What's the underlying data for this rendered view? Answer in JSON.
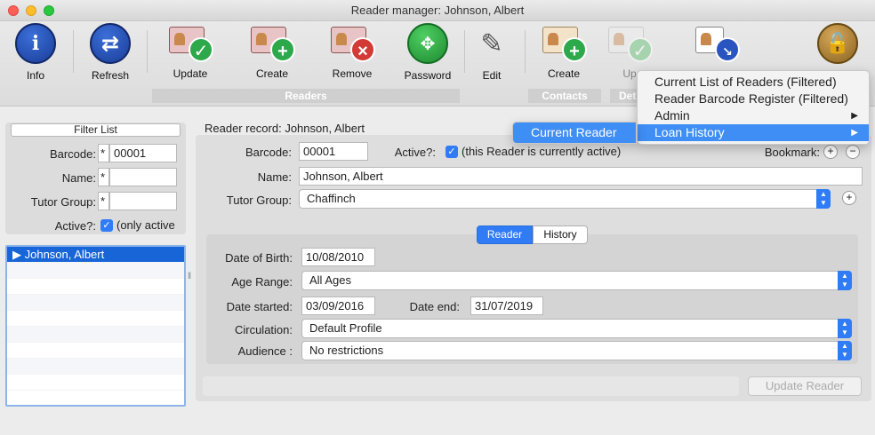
{
  "window": {
    "title": "Reader manager: Johnson, Albert"
  },
  "toolbar": {
    "info": "Info",
    "refresh": "Refresh",
    "update": "Update",
    "create": "Create",
    "remove": "Remove",
    "password": "Password",
    "edit": "Edit",
    "contacts_create": "Create",
    "up_partial": "Up",
    "groups": {
      "readers": "Readers",
      "contacts": "Contacts",
      "det_partial": "Det"
    }
  },
  "filter": {
    "title": "Filter List",
    "barcode_label": "Barcode:",
    "barcode_prefix": "*",
    "barcode_value": "00001",
    "name_label": "Name:",
    "name_prefix": "*",
    "tutor_label": "Tutor Group:",
    "tutor_prefix": "*",
    "active_label": "Active?:",
    "active_text": "(only active"
  },
  "reader_list": {
    "items": [
      "Johnson, Albert"
    ]
  },
  "record": {
    "header": "Reader record: Johnson, Albert",
    "barcode_label": "Barcode:",
    "barcode": "00001",
    "active_label": "Active?:",
    "active_text": "(this Reader is currently active)",
    "bookmark_label": "Bookmark:",
    "name_label": "Name:",
    "name": "Johnson, Albert",
    "tutor_label": "Tutor Group:",
    "tutor": "Chaffinch",
    "tabs": {
      "reader": "Reader",
      "history": "History"
    },
    "dob_label": "Date of Birth:",
    "dob": "10/08/2010",
    "age_label": "Age Range:",
    "age": "All Ages",
    "started_label": "Date started:",
    "started": "03/09/2016",
    "end_label": "Date end:",
    "end": "31/07/2019",
    "circ_label": "Circulation:",
    "circ": "Default Profile",
    "aud_label": "Audience :",
    "aud": "No restrictions",
    "update_btn": "Update Reader"
  },
  "menu": {
    "items": [
      "Current List of Readers (Filtered)",
      "Reader Barcode Register (Filtered)",
      "Admin",
      "Loan History"
    ],
    "sub_arrow": "▶",
    "submenu": "Current Reader"
  }
}
